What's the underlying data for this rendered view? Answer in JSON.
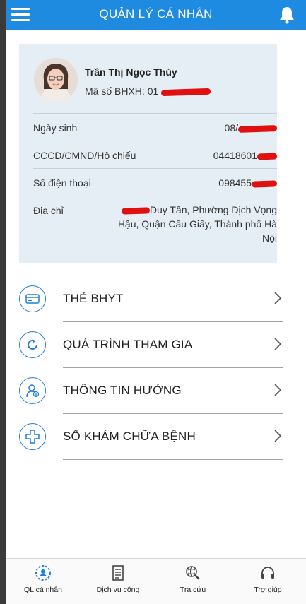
{
  "header": {
    "title": "QUẢN LÝ CÁ NHÂN",
    "menu_icon": "hamburger-menu-icon",
    "notification_icon": "bell-icon",
    "color": "#1f8be0"
  },
  "profile": {
    "name": "Trần Thị Ngọc Thúy",
    "bhxh_label": "Mã số BHXH:",
    "bhxh_value": "01",
    "fields": [
      {
        "label": "Ngày sinh",
        "value": "08/"
      },
      {
        "label": "CCCD/CMND/Hộ chiếu",
        "value": "04418601"
      },
      {
        "label": "Số điện thoại",
        "value": "098455"
      },
      {
        "label": "Địa chỉ",
        "value": "Duy Tân, Phường Dịch Vọng Hậu, Quận Cầu Giấy, Thành phố Hà Nội"
      }
    ]
  },
  "menu": [
    {
      "label": "THẺ BHYT",
      "icon": "card-icon"
    },
    {
      "label": "QUÁ TRÌNH THAM GIA",
      "icon": "refresh-arrow-icon"
    },
    {
      "label": "THÔNG TIN HƯỞNG",
      "icon": "user-info-icon"
    },
    {
      "label": "SỔ KHÁM CHỮA BỆNH",
      "icon": "medical-cross-icon"
    }
  ],
  "tabs": [
    {
      "label": "QL cá nhân",
      "icon": "user-gear-icon"
    },
    {
      "label": "Dịch vụ công",
      "icon": "document-icon"
    },
    {
      "label": "Tra cứu",
      "icon": "search-globe-icon"
    },
    {
      "label": "Trợ giúp",
      "icon": "headset-icon"
    }
  ],
  "colors": {
    "accent": "#1f7fd8",
    "card_bg": "#e6eef5",
    "redaction": "#e01010"
  }
}
